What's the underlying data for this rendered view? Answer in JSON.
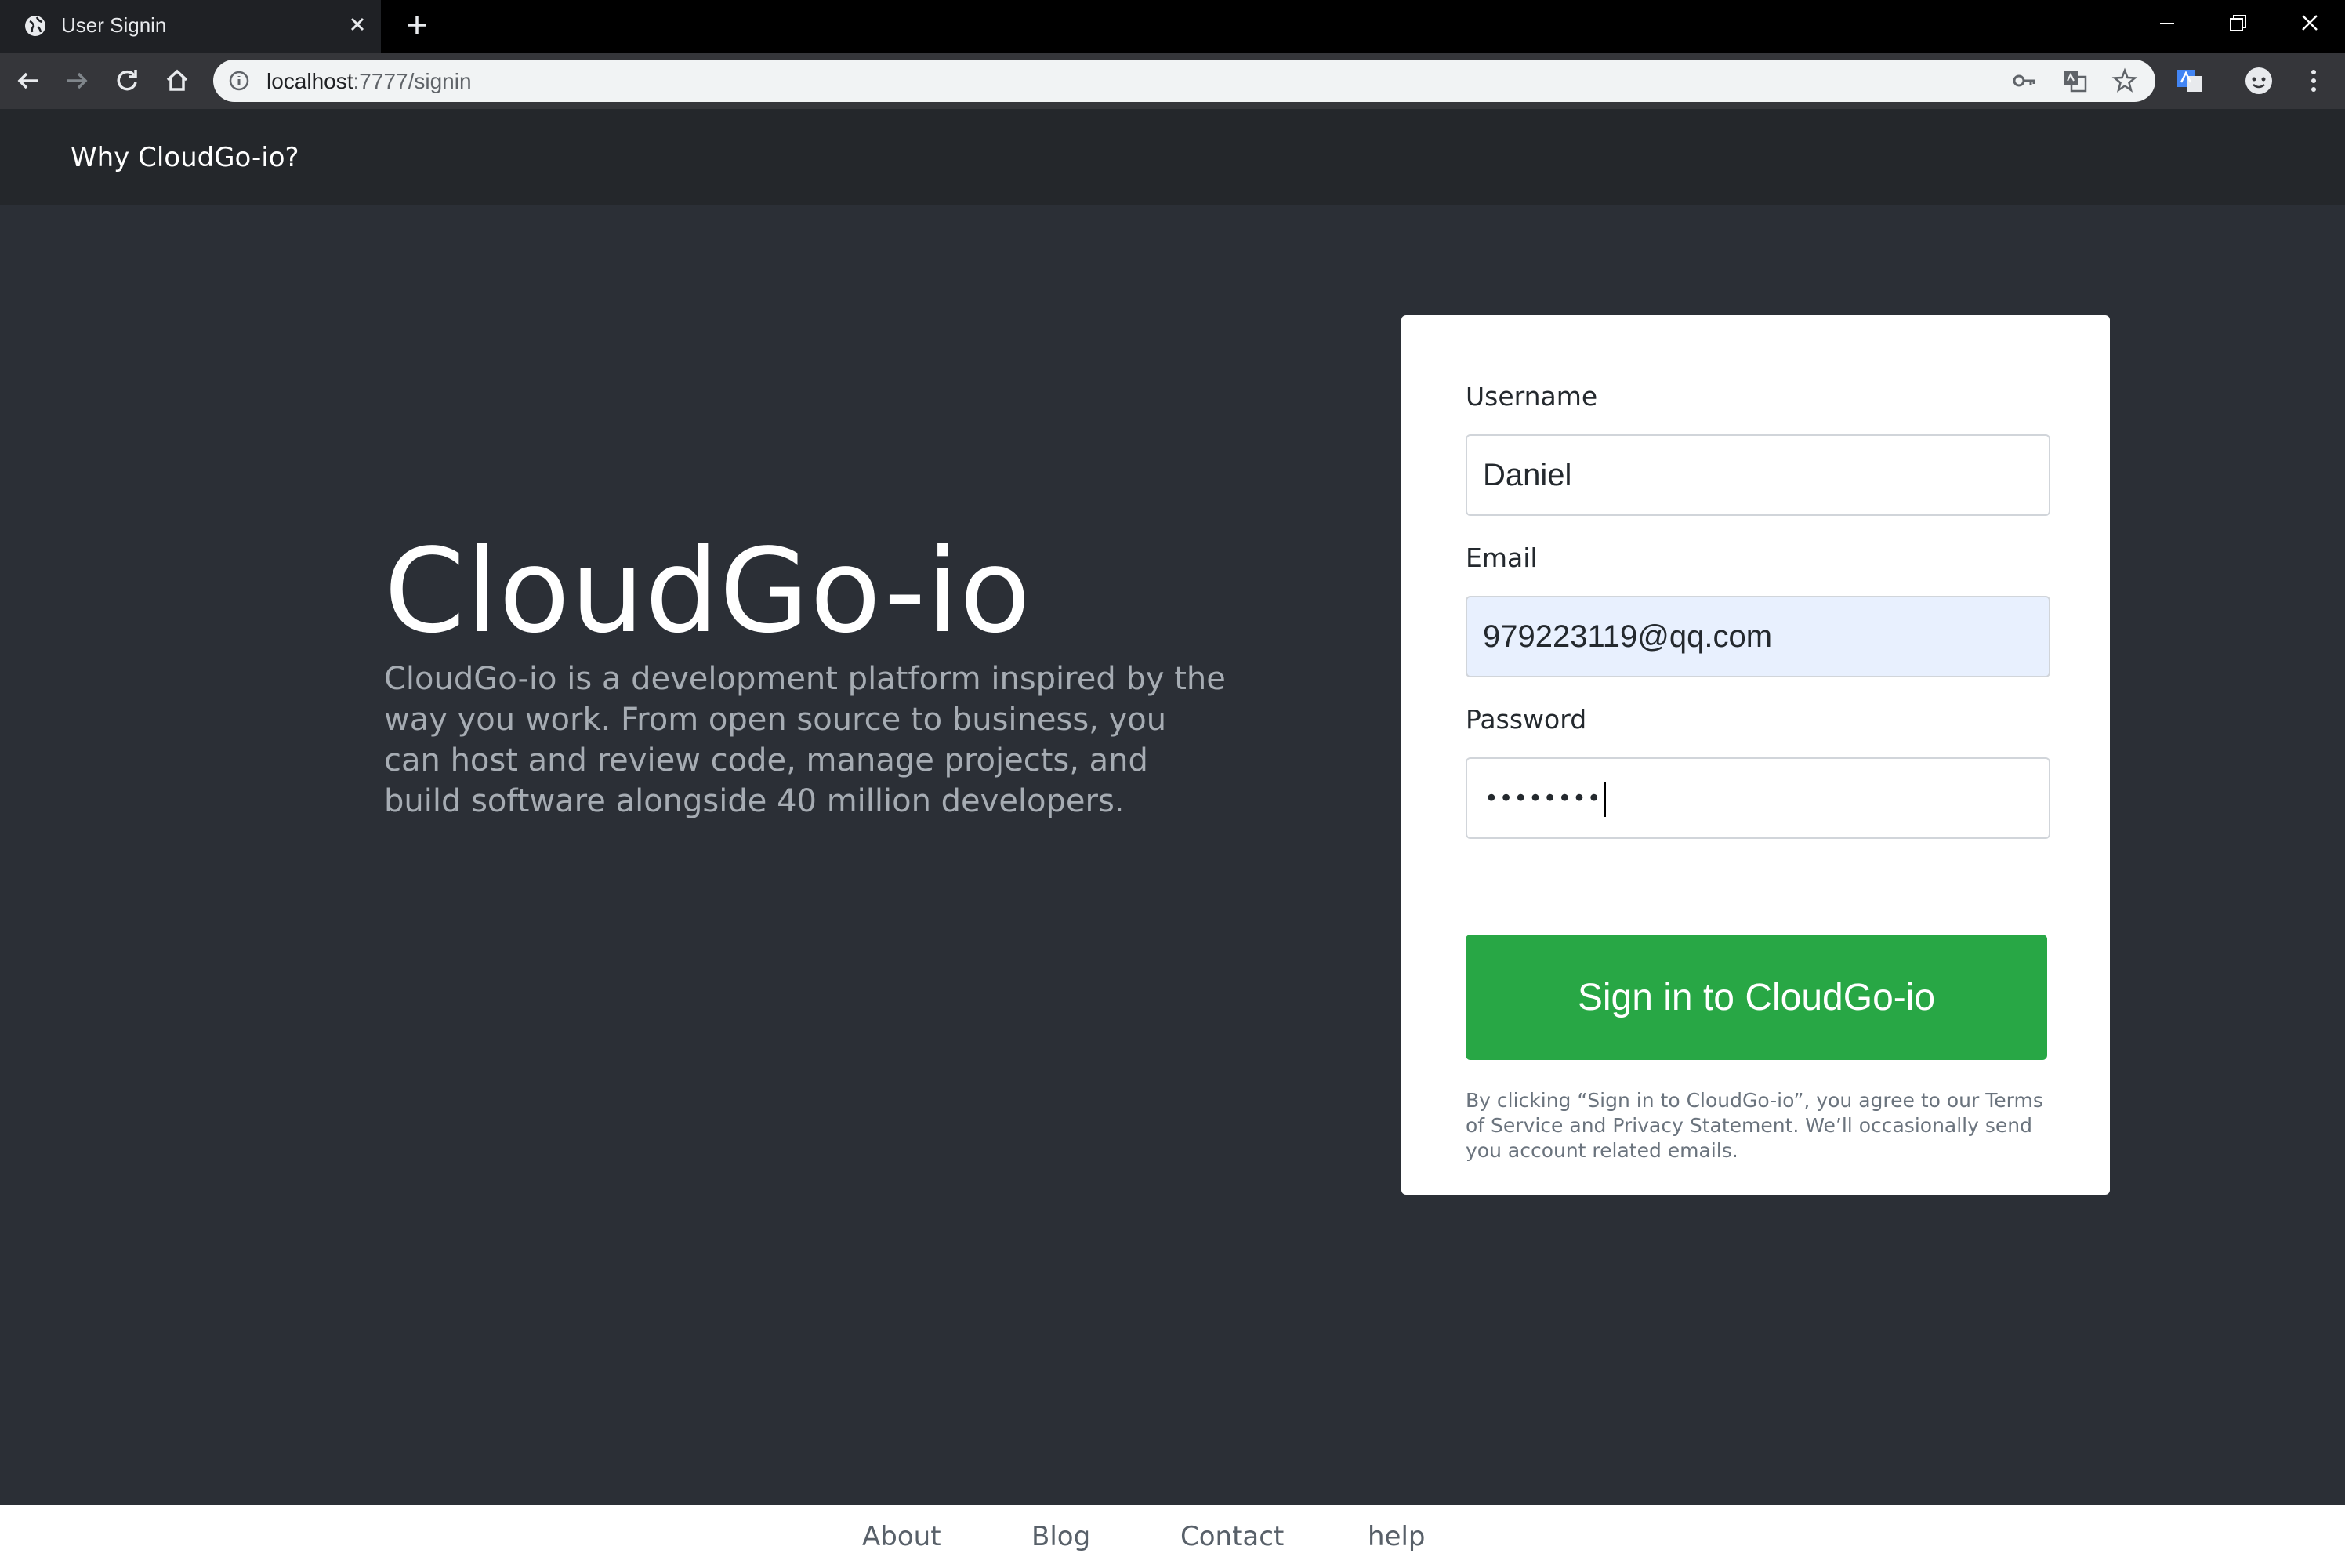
{
  "browser": {
    "tab": {
      "title": "User Signin"
    },
    "address": {
      "host": "localhost",
      "path": ":7777/signin"
    }
  },
  "header": {
    "brand_link": "Why CloudGo-io?"
  },
  "hero": {
    "title": "CloudGo-io",
    "description": "CloudGo-io is a development platform inspired by the way you work. From open source to business, you can host and review code, manage projects, and build software alongside 40 million developers."
  },
  "signin_form": {
    "username": {
      "label": "Username",
      "value": "Daniel"
    },
    "email": {
      "label": "Email",
      "value": "979223119@qq.com"
    },
    "password": {
      "label": "Password",
      "masked_value": "••••••••"
    },
    "submit_label": "Sign in to CloudGo-io",
    "terms": "By clicking “Sign in to CloudGo-io”, you agree to our Terms of Service and Privacy Statement. We’ll occasionally send you account related emails."
  },
  "footer": {
    "links": [
      "About",
      "Blog",
      "Contact",
      "help"
    ]
  },
  "colors": {
    "page_bg": "#2b2f36",
    "header_bg": "#24272b",
    "button_green": "#28a745",
    "autofill_bg": "#e8f0fe"
  }
}
